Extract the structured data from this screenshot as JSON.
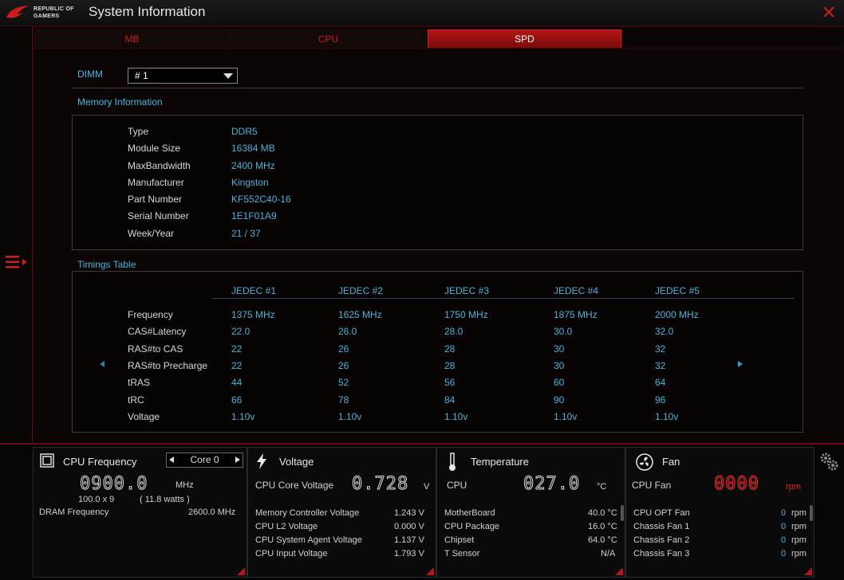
{
  "titlebar": {
    "logo_line1": "REPUBLIC OF",
    "logo_line2": "GAMERS",
    "title": "System Information"
  },
  "tabs": [
    {
      "label": "MB"
    },
    {
      "label": "CPU"
    },
    {
      "label": "SPD"
    }
  ],
  "active_tab": "SPD",
  "dimm": {
    "label": "DIMM",
    "value": "# 1"
  },
  "memory_info": {
    "title": "Memory Information",
    "rows": [
      {
        "label": "Type",
        "value": "DDR5"
      },
      {
        "label": "Module Size",
        "value": "16384 MB"
      },
      {
        "label": "MaxBandwidth",
        "value": "2400 MHz"
      },
      {
        "label": "Manufacturer",
        "value": "Kingston"
      },
      {
        "label": "Part Number",
        "value": "KF552C40-16"
      },
      {
        "label": "Serial Number",
        "value": "1E1F01A9"
      },
      {
        "label": "Week/Year",
        "value": "21 / 37"
      }
    ]
  },
  "timings": {
    "title": "Timings Table",
    "columns": [
      "JEDEC #1",
      "JEDEC #2",
      "JEDEC #3",
      "JEDEC #4",
      "JEDEC #5"
    ],
    "rows": [
      {
        "label": "Frequency",
        "values": [
          "1375 MHz",
          "1625 MHz",
          "1750 MHz",
          "1875 MHz",
          "2000 MHz"
        ]
      },
      {
        "label": "CAS#Latency",
        "values": [
          "22.0",
          "26.0",
          "28.0",
          "30.0",
          "32.0"
        ]
      },
      {
        "label": "RAS#to CAS",
        "values": [
          "22",
          "26",
          "28",
          "30",
          "32"
        ]
      },
      {
        "label": "RAS#to Precharge",
        "values": [
          "22",
          "26",
          "28",
          "30",
          "32"
        ]
      },
      {
        "label": "tRAS",
        "values": [
          "44",
          "52",
          "56",
          "60",
          "64"
        ]
      },
      {
        "label": "tRC",
        "values": [
          "66",
          "78",
          "84",
          "90",
          "96"
        ]
      },
      {
        "label": "Voltage",
        "values": [
          "1.10v",
          "1.10v",
          "1.10v",
          "1.10v",
          "1.10v"
        ]
      }
    ]
  },
  "cpu_freq": {
    "title": "CPU Frequency",
    "core": "Core 0",
    "value": "0900.0",
    "unit": "MHz",
    "multiplier": "100.0   x   9",
    "watts": "( 11.8    watts )",
    "dram_label": "DRAM Frequency",
    "dram_value": "2600.0   MHz"
  },
  "voltage": {
    "title": "Voltage",
    "main_label": "CPU Core Voltage",
    "main_value": "0.728",
    "main_unit": "V",
    "rows": [
      {
        "label": "Memory Controller Voltage",
        "value": "1.243   V"
      },
      {
        "label": "CPU L2 Voltage",
        "value": "0.000   V"
      },
      {
        "label": "CPU System Agent Voltage",
        "value": "1.137   V"
      },
      {
        "label": "CPU Input Voltage",
        "value": "1.793   V"
      }
    ]
  },
  "temperature": {
    "title": "Temperature",
    "main_label": "CPU",
    "main_value": "027.0",
    "main_unit": "°C",
    "rows": [
      {
        "label": "MotherBoard",
        "value": "40.0 °C"
      },
      {
        "label": "CPU Package",
        "value": "16.0 °C"
      },
      {
        "label": "Chipset",
        "value": "64.0 °C"
      },
      {
        "label": "T Sensor",
        "value": "N/A"
      }
    ]
  },
  "fan": {
    "title": "Fan",
    "main_label": "CPU Fan",
    "main_value": "0000",
    "main_unit": "rpm",
    "rows": [
      {
        "label": "CPU OPT Fan",
        "value": "0",
        "unit": "rpm"
      },
      {
        "label": "Chassis Fan 1",
        "value": "0",
        "unit": "rpm"
      },
      {
        "label": "Chassis Fan 2",
        "value": "0",
        "unit": "rpm"
      },
      {
        "label": "Chassis Fan 3",
        "value": "0",
        "unit": "rpm"
      }
    ]
  },
  "colors": {
    "accent": "#b41414",
    "label_blue": "#46b4dc"
  },
  "icons": [
    "rog-logo-icon",
    "close-icon",
    "menu-icon",
    "chevron-down-icon",
    "cpu-chip-icon",
    "lightning-icon",
    "thermometer-icon",
    "fan-icon",
    "gear-icon"
  ]
}
